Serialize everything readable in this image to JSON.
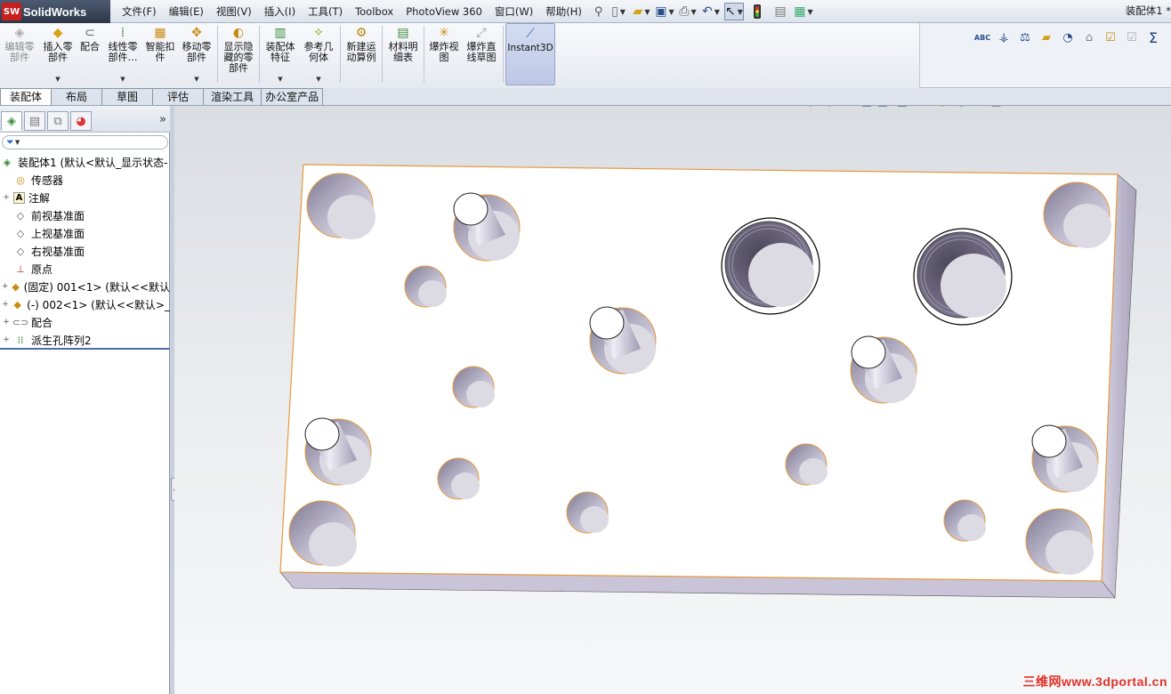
{
  "app": {
    "logo_badge": "SW",
    "logo_name": "SolidWorks",
    "document_title": "装配体1 *"
  },
  "menu": {
    "items": [
      "文件(F)",
      "编辑(E)",
      "视图(V)",
      "插入(I)",
      "工具(T)",
      "Toolbox",
      "PhotoView 360",
      "窗口(W)",
      "帮助(H)"
    ],
    "pin_icon": "pushpin-icon"
  },
  "quick_toolbar": {
    "icons": [
      "new-document-icon",
      "open-folder-icon",
      "save-icon",
      "print-icon",
      "undo-icon",
      "select-arrow-icon",
      "rebuild-traffic-light-icon",
      "file-properties-icon",
      "options-icon"
    ]
  },
  "command_manager": {
    "buttons": [
      {
        "label": "编辑零\n部件",
        "icon": "edit-component-icon",
        "enabled": false,
        "dropdown": false
      },
      {
        "label": "插入零\n部件",
        "icon": "insert-component-icon",
        "enabled": true,
        "dropdown": true
      },
      {
        "label": "配合",
        "icon": "mate-paperclip-icon",
        "enabled": true,
        "dropdown": false
      },
      {
        "label": "线性零\n部件…",
        "icon": "linear-pattern-icon",
        "enabled": true,
        "dropdown": true
      },
      {
        "label": "智能扣\n件",
        "icon": "smart-fasteners-icon",
        "enabled": true,
        "dropdown": false
      },
      {
        "label": "移动零\n部件",
        "icon": "move-component-icon",
        "enabled": true,
        "dropdown": true
      },
      {
        "label": "显示隐\n藏的零\n部件",
        "icon": "show-hidden-components-icon",
        "enabled": true,
        "dropdown": false
      },
      {
        "label": "装配体\n特征",
        "icon": "assembly-features-icon",
        "enabled": true,
        "dropdown": true
      },
      {
        "label": "参考几\n何体",
        "icon": "reference-geometry-icon",
        "enabled": true,
        "dropdown": true
      },
      {
        "label": "新建运\n动算例",
        "icon": "new-motion-study-icon",
        "enabled": true,
        "dropdown": false
      },
      {
        "label": "材料明\n细表",
        "icon": "bill-of-materials-icon",
        "enabled": true,
        "dropdown": false
      },
      {
        "label": "爆炸视\n图",
        "icon": "exploded-view-icon",
        "enabled": true,
        "dropdown": false
      },
      {
        "label": "爆炸直\n线草图",
        "icon": "explode-line-sketch-icon",
        "enabled": true,
        "dropdown": false
      },
      {
        "label": "Instant3D",
        "icon": "instant3d-icon",
        "enabled": true,
        "active": true,
        "dropdown": false
      }
    ],
    "right_icons": [
      "spell-check-icon",
      "dimension-icon",
      "balance-icon",
      "sticky-note-icon",
      "gauge-icon",
      "lock-icon",
      "checkbox-icon",
      "checkbox-disabled-icon",
      "sum-icon"
    ],
    "right_glyph_abc": "ABC",
    "right_glyph_sum": "Σ"
  },
  "tabs": [
    {
      "label": "装配体",
      "active": true
    },
    {
      "label": "布局",
      "active": false
    },
    {
      "label": "草图",
      "active": false
    },
    {
      "label": "评估",
      "active": false
    },
    {
      "label": "渲染工具",
      "active": false
    },
    {
      "label": "办公室产品",
      "active": false
    }
  ],
  "feature_manager": {
    "panel_tabs": [
      "feature-tree-icon",
      "property-manager-icon",
      "configuration-manager-icon",
      "display-manager-icon"
    ],
    "expand_glyph": "»",
    "filter_glyph": "▼",
    "tree": [
      {
        "label": "装配体1  (默认<默认_显示状态-",
        "icon": "assembly-icon",
        "expander": "",
        "indent": 0
      },
      {
        "label": "传感器",
        "icon": "sensor-icon",
        "expander": "",
        "indent": 1
      },
      {
        "label": "注解",
        "icon": "annotation-icon",
        "expander": "+",
        "indent": 1
      },
      {
        "label": "前视基准面",
        "icon": "plane-icon",
        "expander": "",
        "indent": 1
      },
      {
        "label": "上视基准面",
        "icon": "plane-icon",
        "expander": "",
        "indent": 1
      },
      {
        "label": "右视基准面",
        "icon": "plane-icon",
        "expander": "",
        "indent": 1
      },
      {
        "label": "原点",
        "icon": "origin-icon",
        "expander": "",
        "indent": 1
      },
      {
        "label": "(固定) 001<1> (默认<<默认",
        "icon": "part-icon",
        "expander": "+",
        "indent": 1
      },
      {
        "label": "(-) 002<1> (默认<<默认>_",
        "icon": "part-icon",
        "expander": "+",
        "indent": 1
      },
      {
        "label": "配合",
        "icon": "mates-icon",
        "expander": "+",
        "indent": 1
      },
      {
        "label": "派生孔阵列2",
        "icon": "derived-pattern-icon",
        "expander": "+",
        "indent": 1
      }
    ]
  },
  "headsup_toolbar": {
    "icons": [
      "zoom-to-fit-icon",
      "zoom-to-area-icon",
      "previous-view-icon",
      "section-view-icon",
      "view-orientation-icon",
      "display-style-icon",
      "hide-show-items-icon",
      "edit-appearance-icon",
      "apply-scene-icon",
      "view-settings-icon"
    ],
    "dropdowns": [
      false,
      false,
      false,
      false,
      true,
      true,
      true,
      false,
      true,
      true,
      true
    ]
  },
  "watermark": "三维网www.3dportal.cn",
  "colors": {
    "accent": "#4c6ea8",
    "edge_highlight": "#e69a3c",
    "plate_face": "#ffffff",
    "plate_side": "#b9b3c9"
  }
}
